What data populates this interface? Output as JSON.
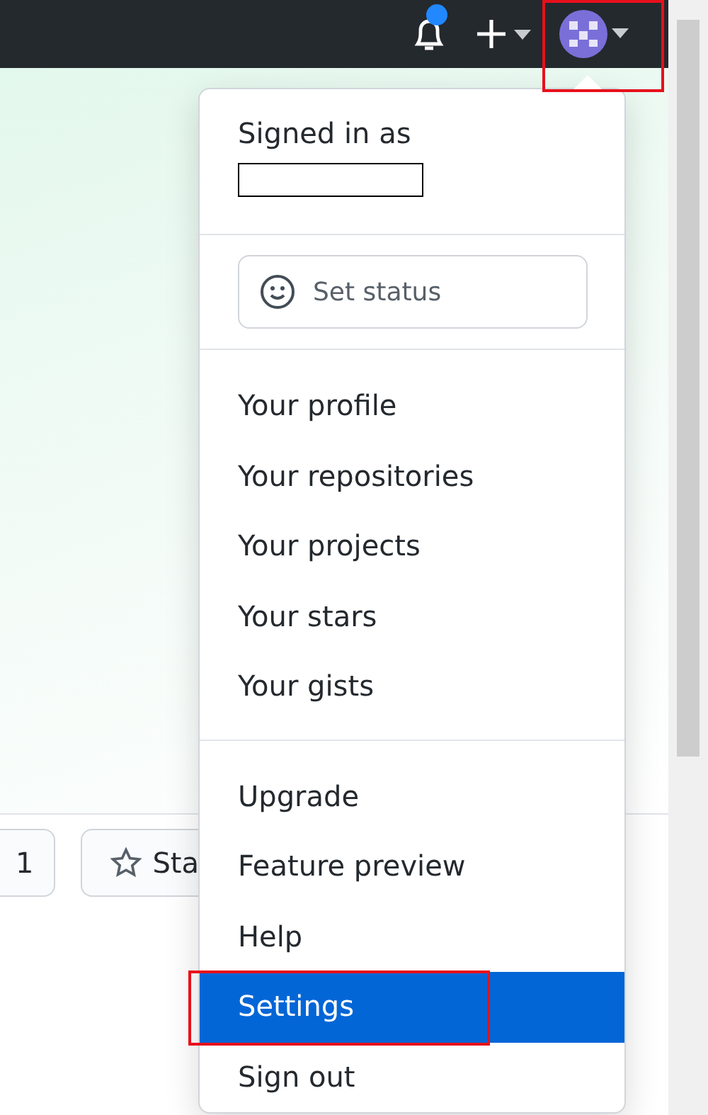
{
  "header": {
    "notification_unread": true,
    "avatar_highlighted": true
  },
  "dropdown": {
    "signed_in_label": "Signed in as",
    "username_redacted": true,
    "status_button": "Set status",
    "sections": [
      [
        {
          "label": "Your profile",
          "selected": false,
          "highlighted": false
        },
        {
          "label": "Your repositories",
          "selected": false,
          "highlighted": false
        },
        {
          "label": "Your projects",
          "selected": false,
          "highlighted": false
        },
        {
          "label": "Your stars",
          "selected": false,
          "highlighted": false
        },
        {
          "label": "Your gists",
          "selected": false,
          "highlighted": false
        }
      ],
      [
        {
          "label": "Upgrade",
          "selected": false,
          "highlighted": false
        },
        {
          "label": "Feature preview",
          "selected": false,
          "highlighted": false
        },
        {
          "label": "Help",
          "selected": false,
          "highlighted": false
        },
        {
          "label": "Settings",
          "selected": true,
          "highlighted": true
        },
        {
          "label": "Sign out",
          "selected": false,
          "highlighted": false
        }
      ]
    ]
  },
  "background_buttons": [
    {
      "kind": "count",
      "label": "1"
    },
    {
      "kind": "star",
      "label": "Sta"
    }
  ]
}
